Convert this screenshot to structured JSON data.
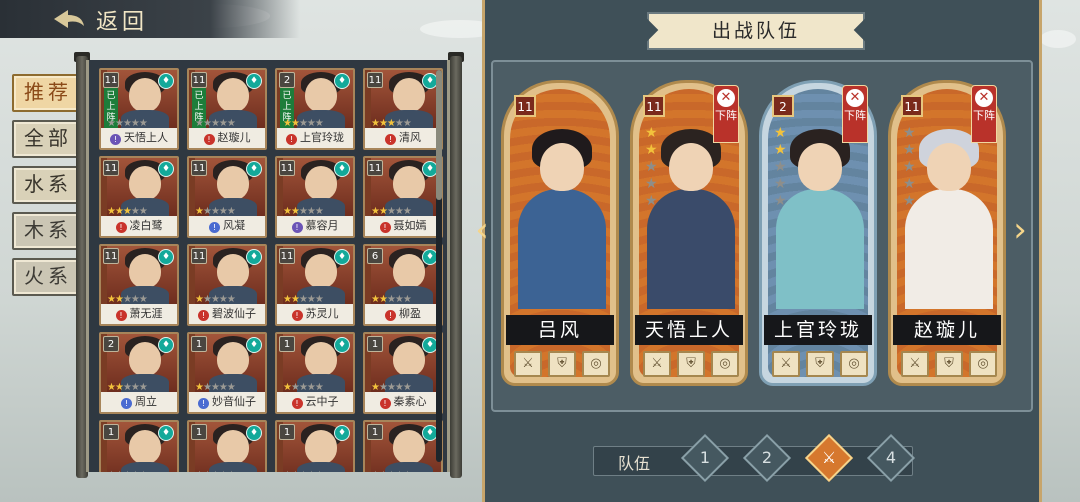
{
  "header": {
    "back_label": "返回"
  },
  "filter_tabs": [
    {
      "label": "推荐",
      "state": "active"
    },
    {
      "label": "全部",
      "state": "normal"
    },
    {
      "label": "水系",
      "state": "selected"
    },
    {
      "label": "木系",
      "state": "gray"
    },
    {
      "label": "火系",
      "state": "gray"
    }
  ],
  "hero_list": [
    {
      "name": "天悟上人",
      "level": "11",
      "stars": 0,
      "deployed": true,
      "deployed_label": "已上阵",
      "role": "purple"
    },
    {
      "name": "赵璇儿",
      "level": "11",
      "stars": 0,
      "deployed": true,
      "deployed_label": "已上阵",
      "role": "red"
    },
    {
      "name": "上官玲珑",
      "level": "2",
      "stars": 2,
      "deployed": true,
      "deployed_label": "已上阵",
      "role": "red"
    },
    {
      "name": "清风",
      "level": "11",
      "stars": 3,
      "deployed": false,
      "role": "red"
    },
    {
      "name": "凌白鹭",
      "level": "11",
      "stars": 3,
      "deployed": false,
      "role": "red"
    },
    {
      "name": "风凝",
      "level": "11",
      "stars": 1,
      "deployed": false,
      "role": "blue"
    },
    {
      "name": "慕容月",
      "level": "11",
      "stars": 2,
      "deployed": false,
      "role": "purple"
    },
    {
      "name": "聂如嫣",
      "level": "11",
      "stars": 2,
      "deployed": false,
      "role": "red"
    },
    {
      "name": "萧无涯",
      "level": "11",
      "stars": 2,
      "deployed": false,
      "role": "red"
    },
    {
      "name": "碧波仙子",
      "level": "11",
      "stars": 1,
      "deployed": false,
      "role": "red"
    },
    {
      "name": "苏灵儿",
      "level": "11",
      "stars": 2,
      "deployed": false,
      "role": "red"
    },
    {
      "name": "柳盈",
      "level": "6",
      "stars": 2,
      "deployed": false,
      "role": "red"
    },
    {
      "name": "周立",
      "level": "2",
      "stars": 2,
      "deployed": false,
      "role": "blue"
    },
    {
      "name": "妙音仙子",
      "level": "1",
      "stars": 1,
      "deployed": false,
      "role": "blue"
    },
    {
      "name": "云中子",
      "level": "1",
      "stars": 1,
      "deployed": false,
      "role": "red"
    },
    {
      "name": "秦素心",
      "level": "1",
      "stars": 1,
      "deployed": false,
      "role": "red"
    },
    {
      "name": "",
      "level": "1",
      "stars": 0,
      "deployed": false,
      "role": "red"
    },
    {
      "name": "",
      "level": "1",
      "stars": 0,
      "deployed": false,
      "role": "red"
    },
    {
      "name": "",
      "level": "1",
      "stars": 0,
      "deployed": false,
      "role": "red"
    },
    {
      "name": "",
      "level": "1",
      "stars": 0,
      "deployed": false,
      "role": "red"
    }
  ],
  "battle_team": {
    "title": "出战队伍",
    "members": [
      {
        "name": "吕风",
        "level": "11",
        "stars": 0,
        "removable": false,
        "theme": "orange"
      },
      {
        "name": "天悟上人",
        "level": "11",
        "stars": 2,
        "removable": true,
        "remove_label": "下阵",
        "theme": "orange"
      },
      {
        "name": "上官玲珑",
        "level": "2",
        "stars": 2,
        "removable": true,
        "remove_label": "下阵",
        "theme": "blue"
      },
      {
        "name": "赵璇儿",
        "level": "11",
        "stars": 0,
        "removable": true,
        "remove_label": "下阵",
        "theme": "orange"
      }
    ],
    "team_label": "队伍",
    "teams": [
      "1",
      "2",
      "3",
      "4"
    ],
    "active_team": 3
  }
}
